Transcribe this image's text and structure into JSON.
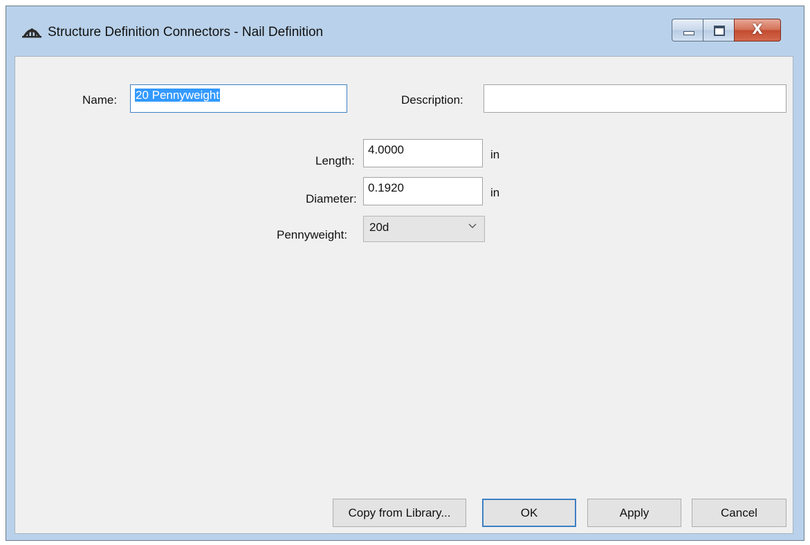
{
  "window": {
    "title": "Structure Definition Connectors - Nail Definition",
    "icon": "bridge-app-icon",
    "controls": {
      "minimize": "minimize-icon",
      "maximize": "maximize-icon",
      "close_glyph": "X"
    }
  },
  "form": {
    "name_label": "Name:",
    "name_value": "20 Pennyweight",
    "description_label": "Description:",
    "description_value": "",
    "length_label": "Length:",
    "length_value": "4.0000",
    "length_unit": "in",
    "diameter_label": "Diameter:",
    "diameter_value": "0.1920",
    "diameter_unit": "in",
    "pennyweight_label": "Pennyweight:",
    "pennyweight_value": "20d"
  },
  "buttons": {
    "copy_from_library": "Copy from Library...",
    "ok": "OK",
    "apply": "Apply",
    "cancel": "Cancel"
  }
}
